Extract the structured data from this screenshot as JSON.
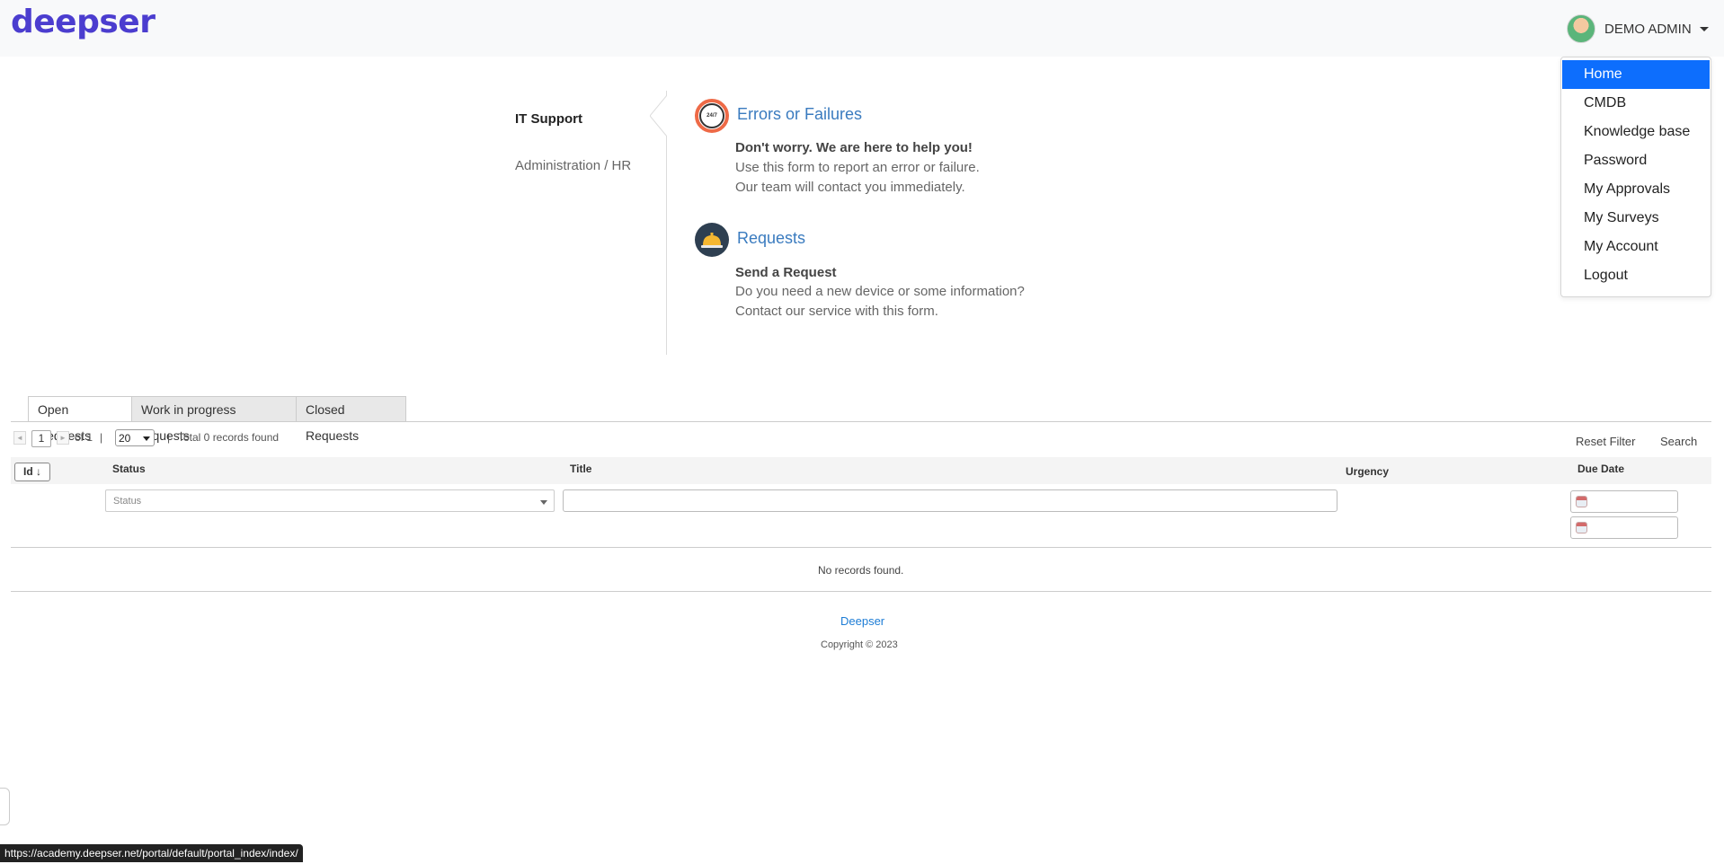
{
  "brand": {
    "logo": "deepser"
  },
  "user_menu": {
    "name": "DEMO ADMIN",
    "items": [
      "Home",
      "CMDB",
      "Knowledge base",
      "Password",
      "My Approvals",
      "My Surveys",
      "My Account",
      "Logout"
    ],
    "active_index": 0
  },
  "categories": [
    {
      "label": "IT Support"
    },
    {
      "label": "Administration / HR"
    }
  ],
  "services": [
    {
      "title": "Errors or Failures",
      "icon_text": "24/7",
      "strong": "Don't worry. We are here to help you!",
      "lines": [
        "Use this form to report an error or failure.",
        "Our team will contact you immediately."
      ]
    },
    {
      "title": "Requests",
      "strong": "Send a Request",
      "lines": [
        "Do you need a new device or some information?",
        "Contact our service with this form."
      ]
    }
  ],
  "tabs": [
    "Open Requests",
    "Work in progress requests",
    "Closed Requests"
  ],
  "pager": {
    "page": "1",
    "of": "of 1",
    "sep1": "|",
    "per_page": "20",
    "sep2": "|",
    "total": "Total 0 records found",
    "prev_icon": "◄",
    "next_icon": "►"
  },
  "grid_actions": {
    "reset": "Reset Filter",
    "search": "Search"
  },
  "columns": {
    "id": "Id",
    "id_sort_icon": "↓",
    "status": "Status",
    "title": "Title",
    "urgency": "Urgency",
    "due_date": "Due Date"
  },
  "filters": {
    "status_placeholder": "Status"
  },
  "empty_message": "No records found.",
  "footer": {
    "link": "Deepser",
    "copyright": "Copyright © 2023"
  },
  "status_bar": {
    "url": "https://academy.deepser.net/portal/default/portal_index/index/"
  },
  "colors": {
    "brand": "#4b3dcf",
    "active": "#0d6efd",
    "link": "#3a7bbf"
  }
}
